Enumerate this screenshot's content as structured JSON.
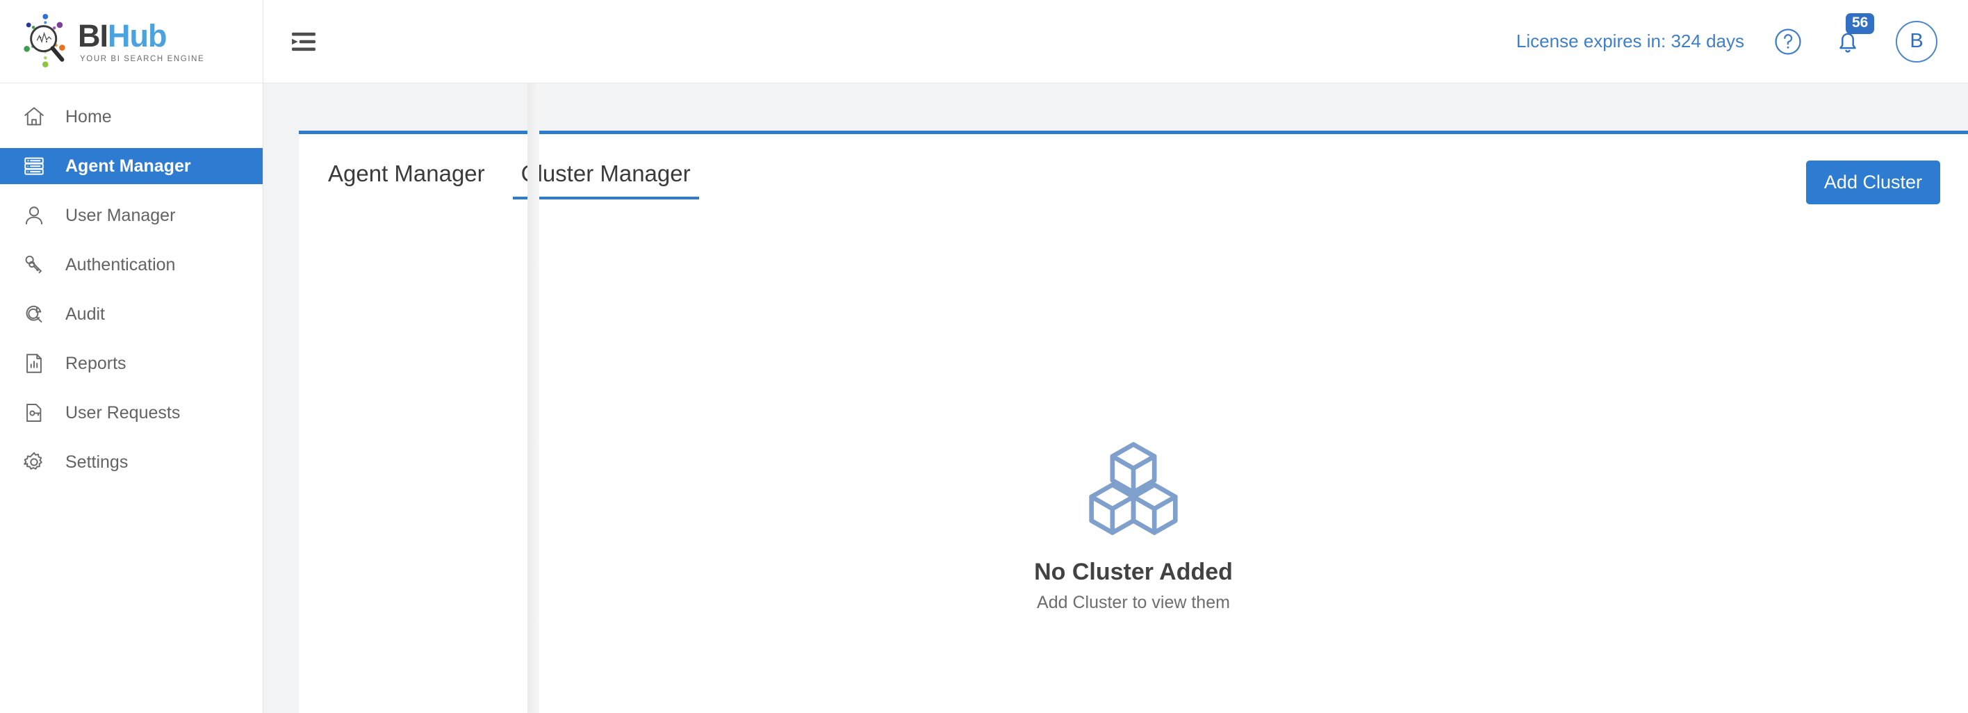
{
  "brand": {
    "name_primary": "BI",
    "name_secondary": "Hub",
    "tagline": "YOUR BI SEARCH ENGINE",
    "logo_icon": "magnifier-analytics-icon",
    "accent_color": "#2e7cd1",
    "secondary_color": "#4aa3e0"
  },
  "sidebar": {
    "items": [
      {
        "label": "Home",
        "icon": "home-icon",
        "active": false
      },
      {
        "label": "Agent Manager",
        "icon": "server-stack-icon",
        "active": true
      },
      {
        "label": "User Manager",
        "icon": "user-icon",
        "active": false
      },
      {
        "label": "Authentication",
        "icon": "keys-icon",
        "active": false
      },
      {
        "label": "Audit",
        "icon": "audit-magnifier-icon",
        "active": false
      },
      {
        "label": "Reports",
        "icon": "report-chart-icon",
        "active": false
      },
      {
        "label": "User Requests",
        "icon": "document-key-icon",
        "active": false
      },
      {
        "label": "Settings",
        "icon": "gear-icon",
        "active": false
      }
    ]
  },
  "topbar": {
    "menu_icon": "collapse-menu-icon",
    "license_text": "License expires in: 324 days",
    "help_icon": "question-circle-icon",
    "notifications_icon": "bell-icon",
    "notifications_count": "56",
    "avatar_initial": "B"
  },
  "main": {
    "tabs": [
      {
        "label": "Agent Manager",
        "active": false
      },
      {
        "label": "Cluster Manager",
        "active": true
      }
    ],
    "primary_action": "Add Cluster",
    "empty_state": {
      "icon": "cluster-cubes-icon",
      "icon_color": "#7fa0cc",
      "title": "No Cluster Added",
      "subtitle": "Add Cluster to view them"
    }
  }
}
